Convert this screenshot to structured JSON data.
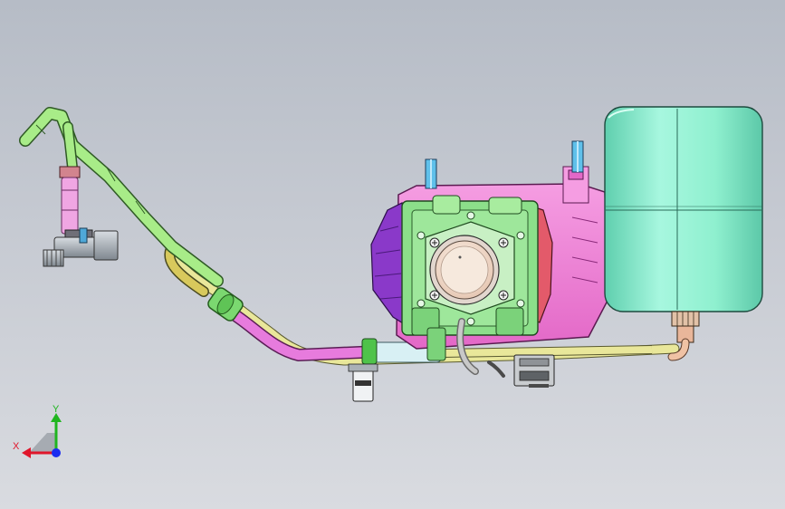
{
  "triad": {
    "x_label": "X",
    "y_label": "Y",
    "x_color": "#e0162b",
    "y_color": "#1fb51f",
    "z_color": "#1b2cf0"
  },
  "colors": {
    "background_top": "#b6bcc6",
    "background_bottom": "#d9dbe0",
    "housing_magenta": "#f27ed6",
    "tank_teal": "#8ff0cf",
    "hose_green": "#a8ec88",
    "hose_yellow": "#e9e79a",
    "hose_magenta": "#e77bdd",
    "pump_green": "#8cdf8a",
    "motor_purple": "#8a39c9",
    "fitting_steel": "#9fa6ad",
    "nozzle_blue": "#5fc0ea"
  }
}
